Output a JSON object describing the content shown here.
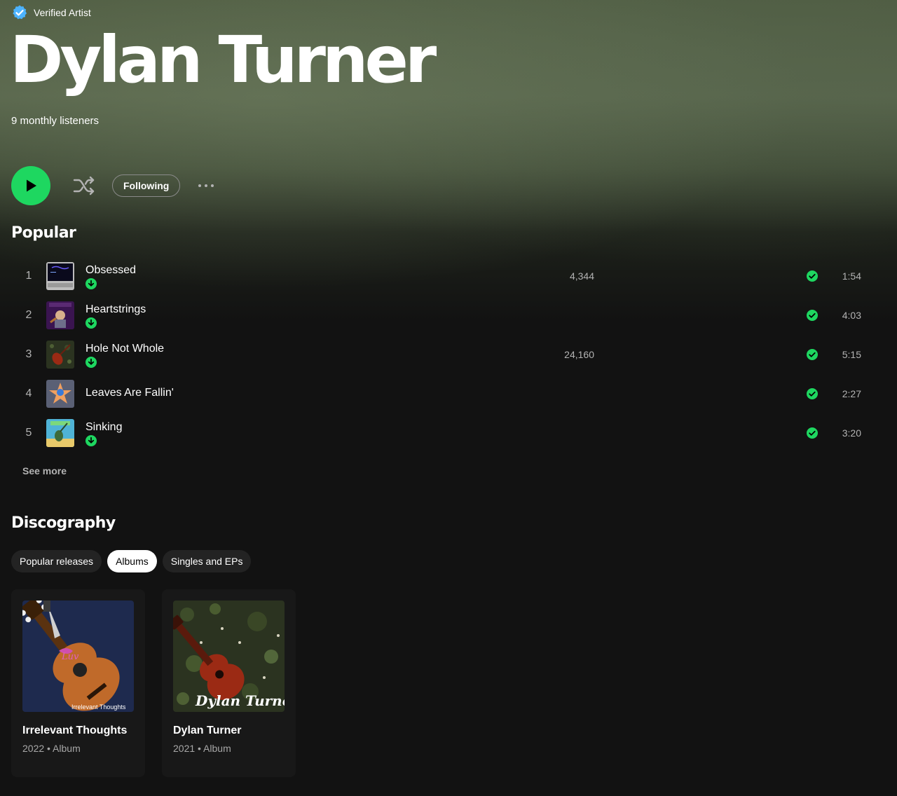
{
  "artist": {
    "verified_label": "Verified Artist",
    "name": "Dylan Turner",
    "monthly_listeners": "9 monthly listeners"
  },
  "actions": {
    "follow_label": "Following"
  },
  "popular": {
    "title": "Popular",
    "tracks": [
      {
        "num": "1",
        "title": "Obsessed",
        "plays": "4,344",
        "duration": "1:54",
        "downloaded": true
      },
      {
        "num": "2",
        "title": "Heartstrings",
        "plays": "",
        "duration": "4:03",
        "downloaded": true
      },
      {
        "num": "3",
        "title": "Hole Not Whole",
        "plays": "24,160",
        "duration": "5:15",
        "downloaded": true
      },
      {
        "num": "4",
        "title": "Leaves Are Fallin'",
        "plays": "",
        "duration": "2:27",
        "downloaded": false
      },
      {
        "num": "5",
        "title": "Sinking",
        "plays": "",
        "duration": "3:20",
        "downloaded": true
      }
    ],
    "see_more": "See more"
  },
  "discography": {
    "title": "Discography",
    "filters": [
      "Popular releases",
      "Albums",
      "Singles and EPs"
    ],
    "active_filter": "Albums",
    "albums": [
      {
        "title": "Irrelevant Thoughts",
        "year": "2022",
        "type": "Album",
        "meta": "2022 • Album",
        "art_caption": "Irrelevant Thoughts"
      },
      {
        "title": "Dylan Turner",
        "year": "2021",
        "type": "Album",
        "meta": "2021 • Album",
        "art_caption": "Dylan Turner"
      }
    ]
  },
  "colors": {
    "accent": "#1ed760",
    "verified_blue": "#4cb3ff",
    "background": "#121212"
  }
}
